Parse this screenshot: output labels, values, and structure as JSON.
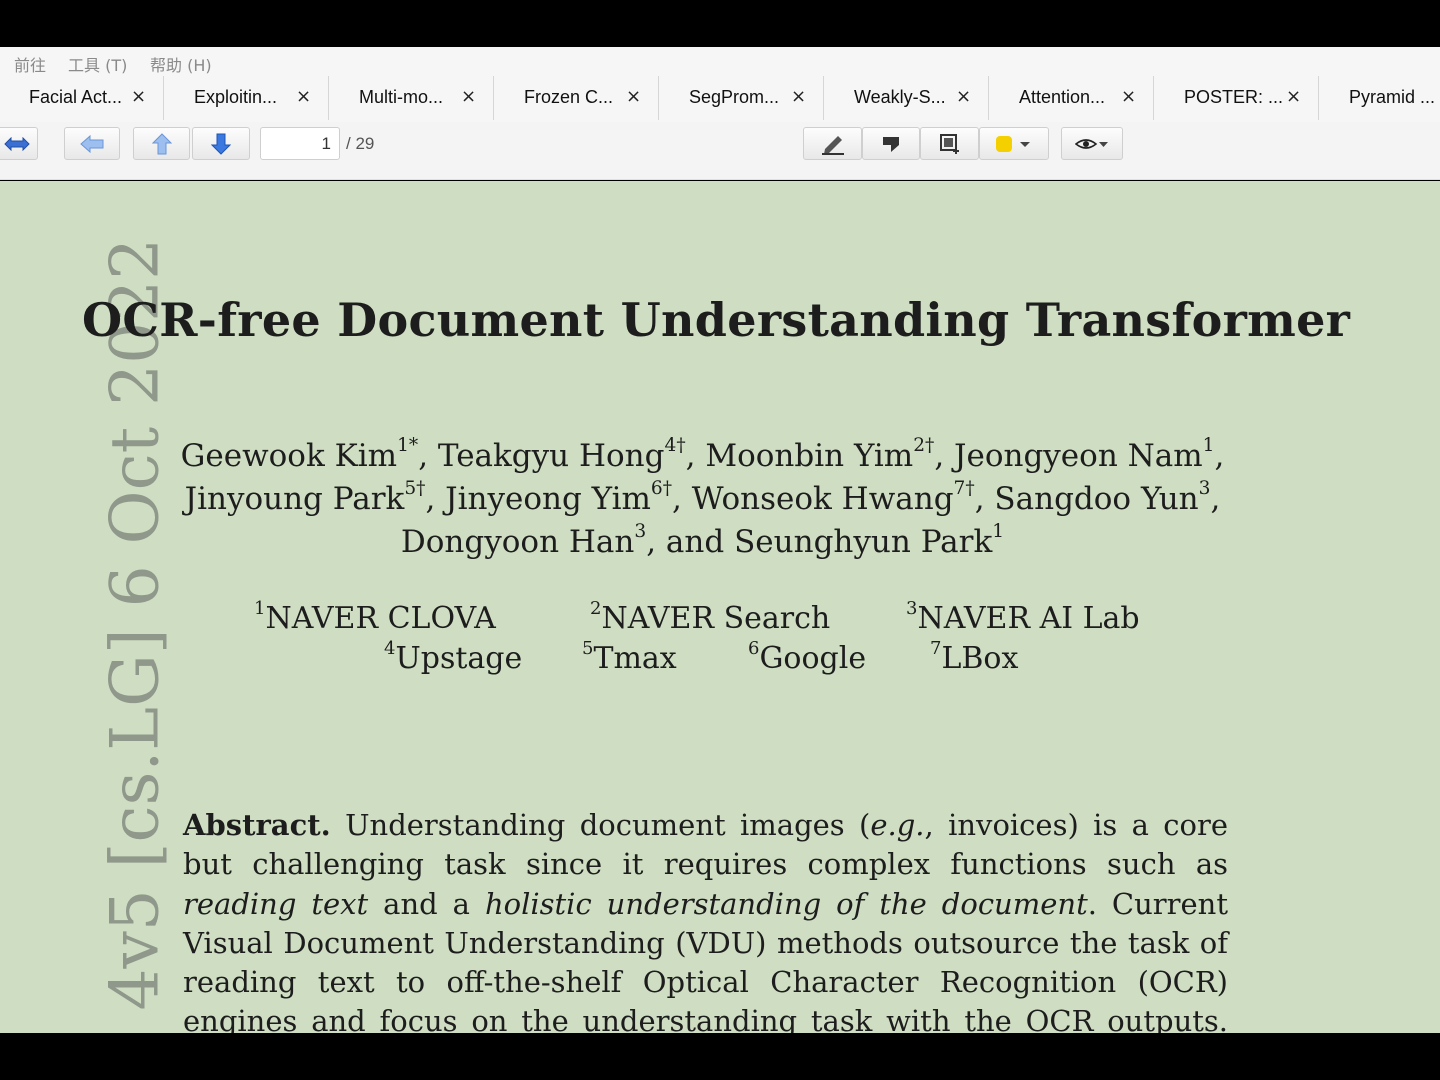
{
  "menu": [
    "前往",
    "工具 (T)",
    "帮助 (H)"
  ],
  "tabs": [
    "Facial Act...",
    "Exploitin...",
    "Multi-mo...",
    "Frozen C...",
    "SegProm...",
    "Weakly-S...",
    "Attention...",
    "POSTER: ...",
    "Pyramid ..."
  ],
  "tab_close_glyph": "×",
  "toolbar": {
    "current_page": "1",
    "total_pages": "/ 29",
    "highlight_color": "#f5d000"
  },
  "document": {
    "title": "OCR-free Document Understanding Transformer",
    "authors": [
      [
        [
          "Geewook Kim",
          "1*"
        ],
        [
          ", Teakgyu Hong",
          "4†"
        ],
        [
          ", Moonbin Yim",
          "2†"
        ],
        [
          ", Jeongyeon Nam",
          "1"
        ],
        [
          ",",
          ""
        ]
      ],
      [
        [
          "Jinyoung Park",
          "5†"
        ],
        [
          ", Jinyeong Yim",
          "6†"
        ],
        [
          ", Wonseok Hwang",
          "7†"
        ],
        [
          ", Sangdoo Yun",
          "3"
        ],
        [
          ",",
          ""
        ]
      ],
      [
        [
          "Dongyoon Han",
          "3"
        ],
        [
          ", and Seunghyun Park",
          "1"
        ]
      ]
    ],
    "affiliations": [
      {
        "num": "1",
        "name": "NAVER CLOVA"
      },
      {
        "num": "2",
        "name": "NAVER Search"
      },
      {
        "num": "3",
        "name": "NAVER AI Lab"
      },
      {
        "num": "4",
        "name": "Upstage"
      },
      {
        "num": "5",
        "name": "Tmax"
      },
      {
        "num": "6",
        "name": "Google"
      },
      {
        "num": "7",
        "name": "LBox"
      }
    ],
    "abstract_label": "Abstract.",
    "abstract_parts": [
      {
        "t": " Understanding document images (",
        "i": false
      },
      {
        "t": "e.g.",
        "i": true
      },
      {
        "t": ", invoices) is a core but challenging task since it requires complex functions such as ",
        "i": false
      },
      {
        "t": "reading text",
        "i": true
      },
      {
        "t": " and a ",
        "i": false
      },
      {
        "t": "holistic understanding of the document",
        "i": true
      },
      {
        "t": ". Current Visual Document Understanding (VDU) methods outsource the task of reading text to off-the-shelf Optical Character Recognition (OCR) engines and focus on the understanding task with the OCR outputs. Although such OCR-based",
        "i": false
      }
    ],
    "arxiv_stamp": "4v5  [cs.LG]  6 Oct 2022"
  }
}
